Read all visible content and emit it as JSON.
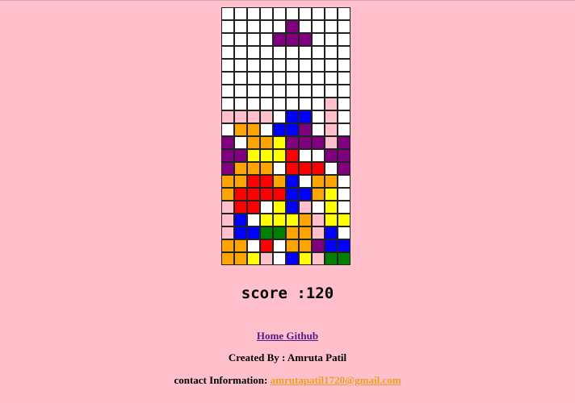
{
  "colors": {
    "W": "#ffffff",
    "P": "#ffc0cb",
    "U": "#800080",
    "O": "#ffa500",
    "B": "#0000ff",
    "Y": "#ffff00",
    "R": "#ff0000",
    "G": "#008000"
  },
  "board": [
    "WWWWWWWWWW",
    "WWWWWUWWWW",
    "WWWWUUUWWW",
    "WWWWWWWWWW",
    "WWWWWWWWWW",
    "WWWWWWWWWW",
    "WWWWWWWWWW",
    "WWWWWWWWPW",
    "PPPPWBBWPW",
    "WOOWBBUWPW",
    "UWOOYUUUPU",
    "UUYYYRWWUU",
    "UOOOWRRRWU",
    "OORROBWOOW",
    "ORRRRBBOYW",
    "PRRWYBPWYW",
    "PBWYYYOPYY",
    "PBBGGOOPBW",
    "OOWRWOOUBB",
    "OOYPWBYPGG"
  ],
  "score_text": "score :120",
  "home_link_text": "Home Github",
  "credit_text": "Created By : Amruta Patil",
  "contact_label": "contact Information: ",
  "contact_email": "amrutapatil1720@gmail.com"
}
